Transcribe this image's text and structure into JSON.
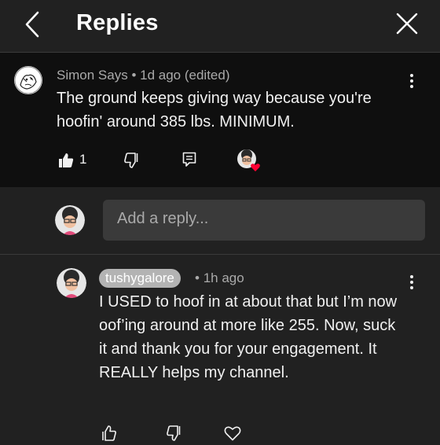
{
  "header": {
    "title": "Replies",
    "back_icon": "chevron-left-icon",
    "close_icon": "close-icon"
  },
  "parent_comment": {
    "author": "Simon Says",
    "separator": "•",
    "time": "1d ago",
    "edited": "(edited)",
    "text": "The ground keeps giving way because you're hoofin' around 385 lbs. MINIMUM.",
    "likes": "1",
    "icons": [
      "thumbs-up-icon",
      "thumbs-down-icon",
      "reply-icon",
      "creator-heart-icon"
    ]
  },
  "reply_input": {
    "placeholder": "Add a reply..."
  },
  "reply": {
    "author": "tushygalore",
    "separator": "•",
    "time": "1h ago",
    "text": "I USED to hoof in at about that but I’m now oof’ing around at more like 255. Now, suck it and thank you for your engagement. It REALLY helps my channel.",
    "icons": [
      "thumbs-up-icon",
      "thumbs-down-icon",
      "heart-icon"
    ]
  },
  "colors": {
    "background": "#212121",
    "comment_background": "#0f0f0f",
    "text": "#f1f1f1",
    "meta": "#aaaaaa",
    "chip": "#b3b3b3",
    "heart": "#ff0033"
  }
}
